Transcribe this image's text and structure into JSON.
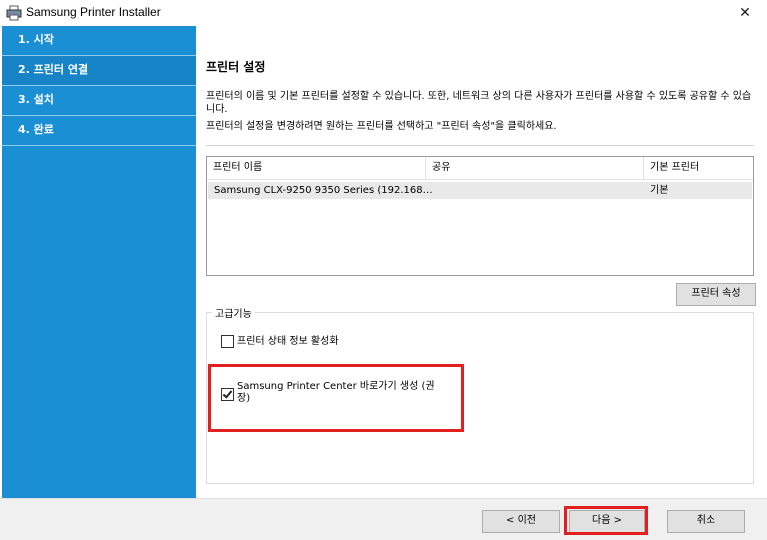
{
  "window": {
    "title": "Samsung Printer Installer",
    "close_glyph": "✕"
  },
  "sidebar": {
    "steps": [
      {
        "label": "1. 시작"
      },
      {
        "label": "2. 프린터 연결"
      },
      {
        "label": "3. 설치"
      },
      {
        "label": "4. 완료"
      }
    ],
    "active_index": 1,
    "color": "#1a8fd3"
  },
  "main": {
    "title": "프린터 설정",
    "description_1": "프린터의 이름 및 기본 프린터를 설정할 수 있습니다. 또한, 네트워크 상의 다른 사용자가 프린터를 사용할 수 있도록 공유할 수 있습니다.",
    "description_2": "프린터의 설정을 변경하려면 원하는 프린터를 선택하고 \"프린터 속성\"을 클릭하세요.",
    "table": {
      "columns": [
        "프린터 이름",
        "공유",
        "기본 프린터"
      ],
      "rows": [
        {
          "name": "Samsung CLX-9250 9350 Series (192.168…",
          "shared": "",
          "default": "기본"
        }
      ]
    },
    "properties_button": "프린터 속성",
    "advanced": {
      "legend": "고급기능",
      "options": [
        {
          "label": "프린터 상태 정보 활성화",
          "checked": false
        },
        {
          "label": "Samsung Printer Center 바로가기 생성 (권장)",
          "checked": true
        }
      ]
    }
  },
  "footer": {
    "back_button": "< 이전",
    "next_button": "다음 >",
    "cancel_button": "취소"
  },
  "colors": {
    "highlight": "#e3201f",
    "sidebar": "#1a8fd3"
  }
}
